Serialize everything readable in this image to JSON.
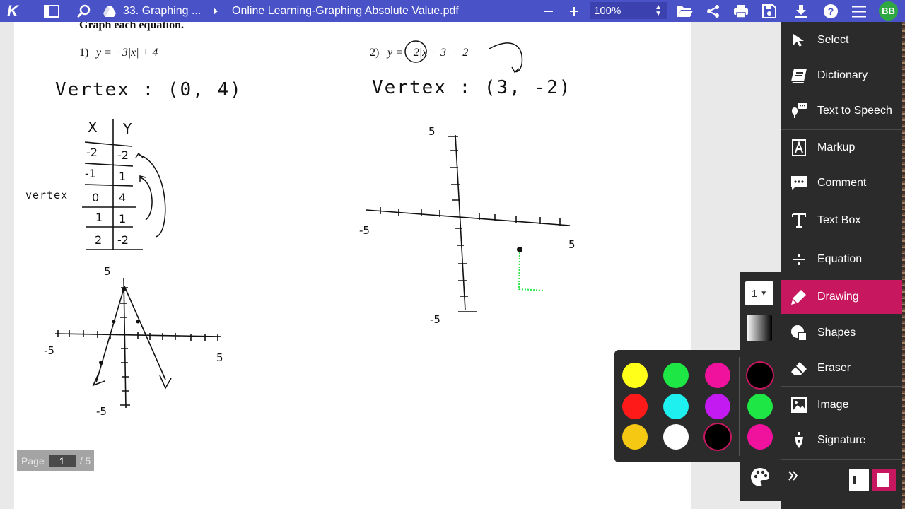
{
  "topbar": {
    "logo": "K",
    "breadcrumb_folder": "33. Graphing ...",
    "file_name": "Online Learning-Graphing Absolute Value.pdf",
    "zoom": "100%",
    "avatar": "BB",
    "icons": [
      "sidebar-toggle-icon",
      "search-icon",
      "folder-drive-icon",
      "chevron-right-icon",
      "minus-icon",
      "plus-icon",
      "open-folder-icon",
      "share-icon",
      "print-icon",
      "save-icon",
      "download-icon",
      "help-icon",
      "menu-icon"
    ],
    "bar_color": "#4a52c8"
  },
  "document": {
    "heading": "Graph each equation.",
    "problems": [
      {
        "number": "1)",
        "equation": "y = −3|x| + 4"
      },
      {
        "number": "2)",
        "equation": "y = −2|x − 3| − 2"
      }
    ],
    "handwriting": {
      "p1_vertex": "Vertex : (0, 4)",
      "p2_vertex": "Vertex : (3, -2)",
      "table_header_x": "X",
      "table_header_y": "Y",
      "table_rows": [
        [
          "-2",
          "-2"
        ],
        [
          "-1",
          "1"
        ],
        [
          "0",
          "4"
        ],
        [
          "1",
          "1"
        ],
        [
          "2",
          "-2"
        ]
      ],
      "vertex_label": "vertex",
      "axis_5": "5",
      "axis_neg5": "-5"
    }
  },
  "pagination": {
    "label": "Page",
    "current": "1",
    "total": "/ 5"
  },
  "sidebar": {
    "items": [
      {
        "label": "Select",
        "icon": "cursor-arrow-icon"
      },
      {
        "label": "Dictionary",
        "icon": "book-icon"
      },
      {
        "label": "Text to Speech",
        "icon": "microphone-speech-icon"
      },
      {
        "label": "Markup",
        "icon": "markup-icon"
      },
      {
        "label": "Comment",
        "icon": "comment-icon"
      },
      {
        "label": "Text Box",
        "icon": "text-box-icon"
      },
      {
        "label": "Equation",
        "icon": "divide-icon"
      },
      {
        "label": "Drawing",
        "icon": "pen-icon"
      },
      {
        "label": "Shapes",
        "icon": "shapes-icon"
      },
      {
        "label": "Eraser",
        "icon": "eraser-icon"
      },
      {
        "label": "Image",
        "icon": "image-icon"
      },
      {
        "label": "Signature",
        "icon": "fountain-pen-icon"
      }
    ],
    "active": "Drawing",
    "active_color": "#c7175f"
  },
  "drawing_options": {
    "stroke_width": "1",
    "colors": [
      "#ffff1a",
      "#1ee644",
      "#f0129c",
      "#000000",
      "#ff1a1a",
      "#1ef0f0",
      "#c21af0",
      "#1ee644",
      "#f5c814",
      "#ffffff",
      "#000000",
      "#f0129c"
    ],
    "selected_color": "#000000"
  }
}
